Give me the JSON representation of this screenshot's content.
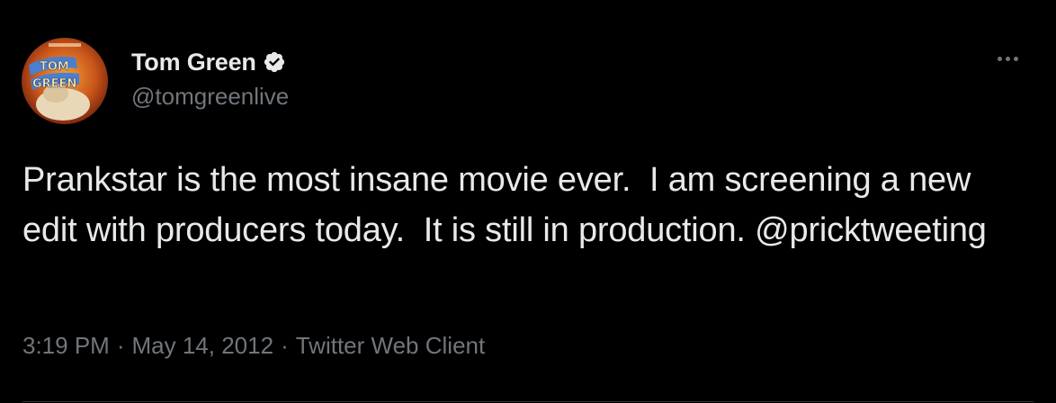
{
  "author": {
    "display_name": "Tom Green",
    "handle": "@tomgreenlive",
    "verified": true,
    "avatar_text": "TOM GREEN"
  },
  "tweet": {
    "text_part1": "Prankstar is the most insane movie ever.  I am screening a new edit with producers today.  It is still in production. ",
    "mention": "@pricktweeting"
  },
  "meta": {
    "time": "3:19 PM",
    "separator": "·",
    "date": "May 14, 2012",
    "source": "Twitter Web Client"
  },
  "icons": {
    "verified": "verified-badge-icon",
    "more": "more-options-icon"
  },
  "colors": {
    "background": "#000000",
    "text": "#e7e9ea",
    "secondary": "#71767b",
    "divider": "#2f3336"
  }
}
